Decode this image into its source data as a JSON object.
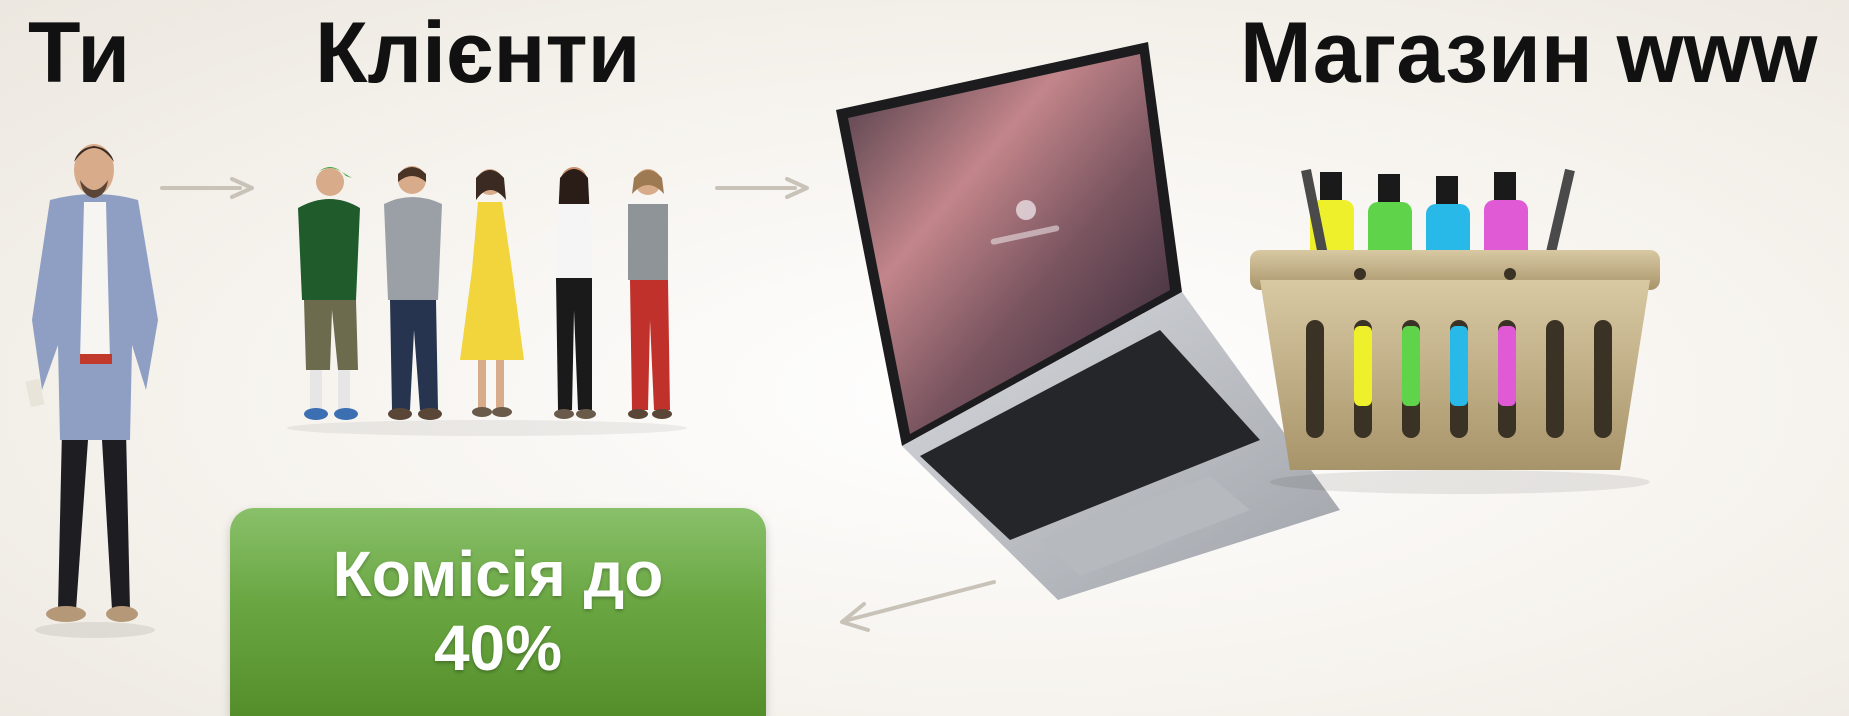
{
  "titles": {
    "you": "Ти",
    "clients": "Клієнти",
    "shop": "Магазин www"
  },
  "commission": {
    "line1": "Комісія до",
    "line2": "40%"
  },
  "colors": {
    "commission_green": "#6aa743",
    "arrow_gray": "#c9c2b8",
    "bottle_colors": [
      "#eef02b",
      "#5fd34a",
      "#29b9e8",
      "#e05ad6"
    ]
  },
  "icons": [
    "arrow-right-icon",
    "arrow-right-icon",
    "arrow-left-icon",
    "person-illustration",
    "people-group-illustration",
    "laptop-illustration",
    "shopping-basket-illustration"
  ]
}
